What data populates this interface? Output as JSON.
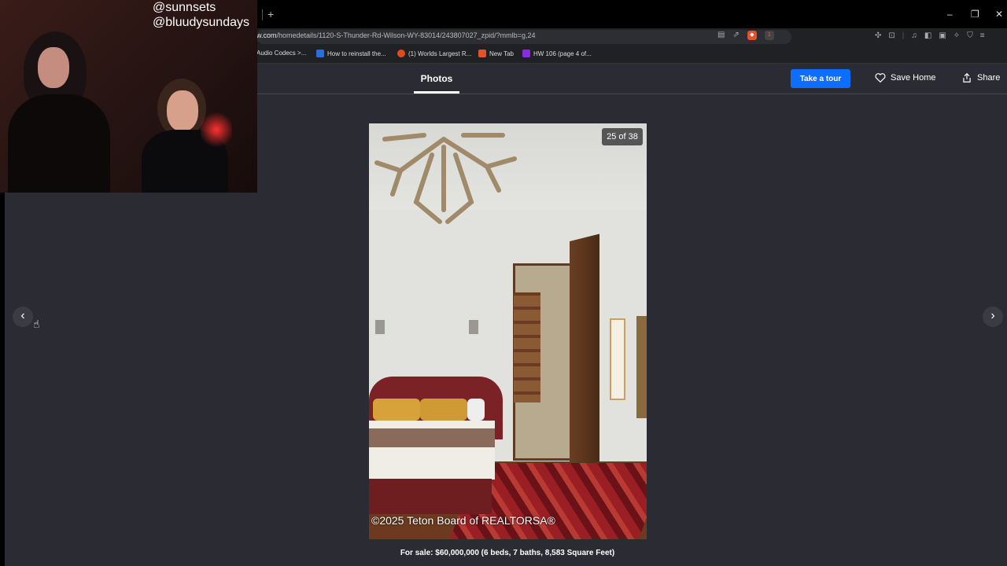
{
  "browser": {
    "new_tab_symbol": "+",
    "url_host": "w.com",
    "url_path": "/homedetails/1120-S-Thunder-Rd-Wilson-WY-83014/243807027_zpid/?mmlb=g,24",
    "brave_badge": "1",
    "window_controls": {
      "minimize": "–",
      "restore": "❐",
      "close": "✕"
    },
    "bookmarks": [
      {
        "label": "Audio Codecs >...",
        "color": "#202124"
      },
      {
        "label": "How to reinstall the...",
        "color": "#2d6cdf"
      },
      {
        "label": "(1) Worlds Largest R...",
        "color": "#e24a1a"
      },
      {
        "label": "New Tab",
        "color": "#e2522b"
      },
      {
        "label": "HW 106 (page 4 of...",
        "color": "#8a2be2"
      }
    ]
  },
  "webcam": {
    "handles": [
      "@sunnsets",
      "@bluudysundays"
    ]
  },
  "header": {
    "photos_tab": "Photos",
    "tour_button": "Take a tour",
    "save_home": "Save Home",
    "share": "Share"
  },
  "viewer": {
    "counter": "25 of 38",
    "copyright": "©2025 Teton Board of REALTORSA®",
    "prev_symbol": "‹",
    "next_symbol": "›",
    "caption": "For sale: $60,000,000 (6 beds, 7 baths, 8,583 Square Feet)"
  }
}
